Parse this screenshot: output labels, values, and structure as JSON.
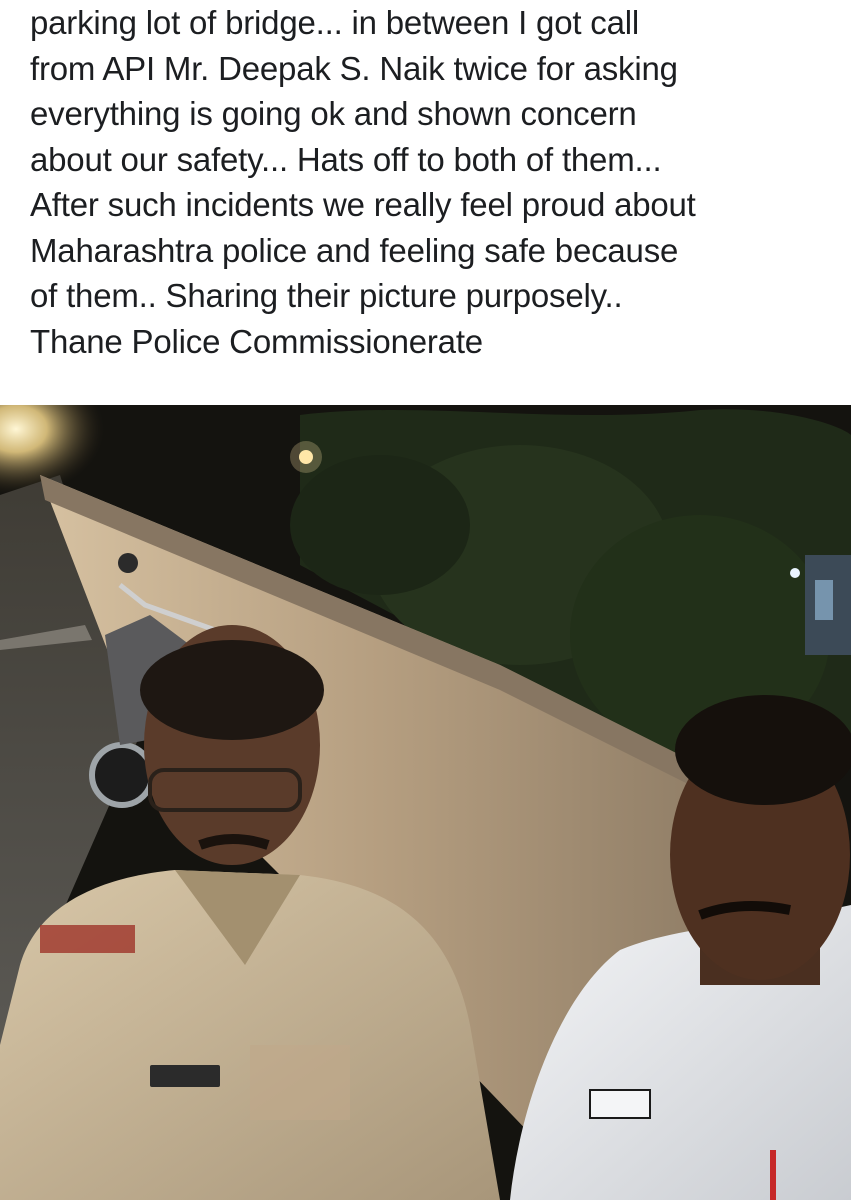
{
  "post": {
    "text_lines": [
      "parking lot of bridge... in between I got call",
      "from API Mr. Deepak S. Naik twice for asking",
      "everything is going ok and shown concern",
      "about our safety... Hats off to both of them...",
      "After such incidents we really feel proud about",
      "Maharashtra police and feeling safe because",
      "of them.. Sharing their picture purposely..",
      "Thane Police Commissionerate"
    ]
  },
  "photo": {
    "subject": "night-selfie-two-police-officers-on-bridge",
    "colors": {
      "sky": "#14130f",
      "foliage": "#1f2a18",
      "wall": "#b8a184",
      "road": "#4a4944",
      "khaki_uniform": "#c9b79a",
      "white_uniform": "#e9ebee",
      "skin": "#5a3b2a",
      "streetlight": "#ffe7a8"
    }
  }
}
